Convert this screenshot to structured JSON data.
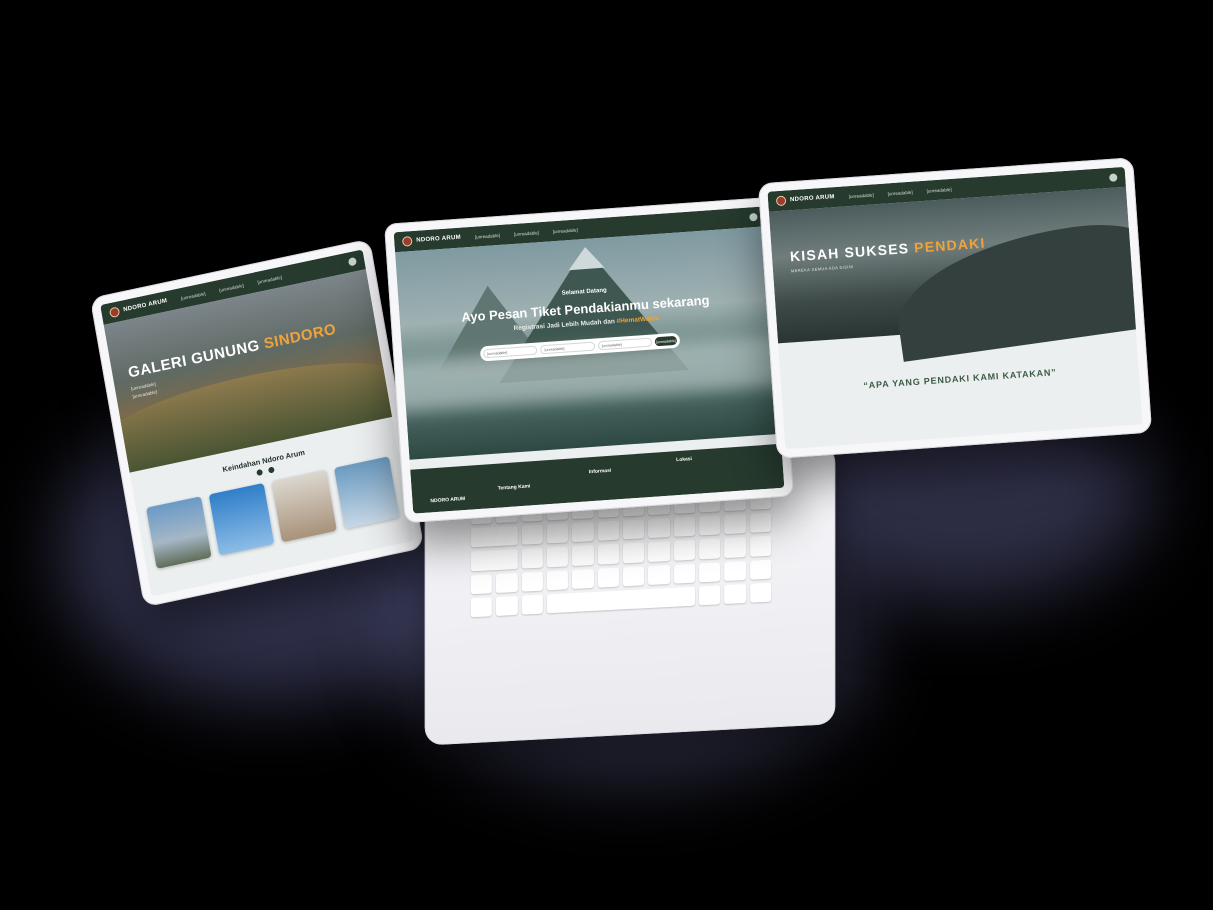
{
  "colors": {
    "nav_bg": "#263a2e",
    "accent": "#f0a33a",
    "device_body": "#f7f7fa"
  },
  "brand": {
    "name": "NDORO ARUM"
  },
  "unreadable": "[unreadable]",
  "left": {
    "title_main": "GALERI GUNUNG ",
    "title_accent": "SINDORO",
    "gallery_title": "Keindahan Ndoro Arum"
  },
  "middle": {
    "greeting": "Selamat Datang",
    "headline": "Ayo Pesan Tiket Pendakianmu sekarang",
    "subline_prefix": "Registrasi Jadi Lebih Mudah dan ",
    "subline_accent": "#HematWaktu",
    "footer": {
      "brand": "NDORO ARUM",
      "about": "Tentang Kami",
      "info": "Informasi",
      "location": "Lokasi"
    }
  },
  "right": {
    "title_main": "KISAH SUKSES ",
    "title_accent": "PENDAKI",
    "subtitle": "MEREKA SEMUA ADA DISINI",
    "quote": "“APA YANG PENDAKI KAMI KATAKAN”"
  }
}
